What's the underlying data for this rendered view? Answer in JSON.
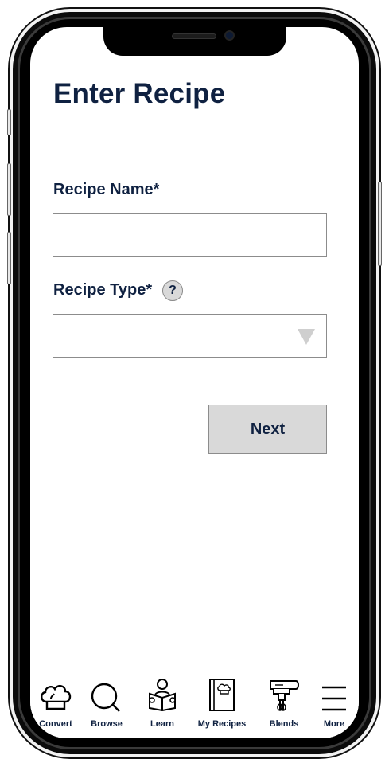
{
  "header": {
    "title": "Enter Recipe"
  },
  "form": {
    "name_label": "Recipe Name*",
    "name_value": "",
    "type_label": "Recipe Type*",
    "help_glyph": "?",
    "type_value": ""
  },
  "actions": {
    "next_label": "Next"
  },
  "tabbar": {
    "tabs": [
      {
        "label": "Convert",
        "icon": "chef-hat-icon"
      },
      {
        "label": "Browse",
        "icon": "search-icon"
      },
      {
        "label": "Learn",
        "icon": "reader-icon"
      },
      {
        "label": "My Recipes",
        "icon": "recipe-book-icon"
      },
      {
        "label": "Blends",
        "icon": "hand-mixer-icon"
      },
      {
        "label": "More",
        "icon": "menu-icon"
      }
    ]
  },
  "colors": {
    "primary_text": "#0f2141",
    "button_bg": "#d9d9d9",
    "border": "#8c8c8c"
  }
}
